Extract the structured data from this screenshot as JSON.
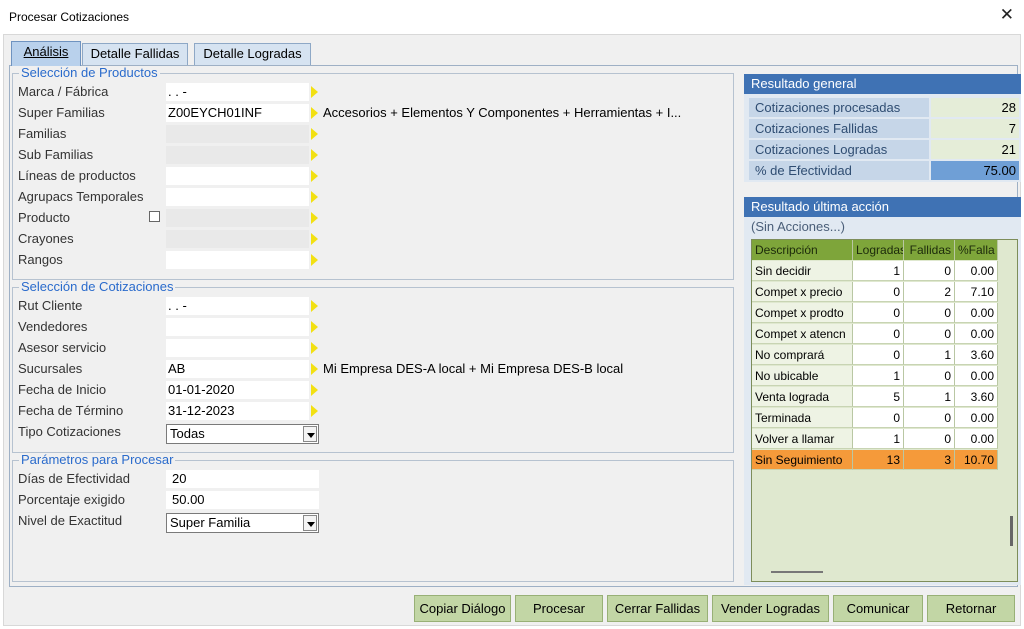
{
  "window": {
    "title": "Procesar Cotizaciones",
    "close_glyph": "✕"
  },
  "tabs": [
    {
      "label": "Análisis"
    },
    {
      "label": "Detalle Fallidas"
    },
    {
      "label": "Detalle Logradas"
    }
  ],
  "productos": {
    "title": "Selección de Productos",
    "marca": {
      "label": "Marca / Fábrica",
      "value": ". .  -"
    },
    "super_familias": {
      "label": "Super Familias",
      "value": "Z00EYCH01INF",
      "desc": "Accesorios + Elementos Y Componentes + Herramientas + I..."
    },
    "familias": {
      "label": "Familias",
      "value": ""
    },
    "sub_familias": {
      "label": "Sub Familias",
      "value": ""
    },
    "lineas": {
      "label": "Líneas de productos",
      "value": ""
    },
    "agrupacs": {
      "label": "Agrupacs Temporales",
      "value": ""
    },
    "producto": {
      "label": "Producto",
      "value": ""
    },
    "crayones": {
      "label": "Crayones",
      "value": ""
    },
    "rangos": {
      "label": "Rangos",
      "value": ""
    }
  },
  "cotizaciones": {
    "title": "Selección de Cotizaciones",
    "rut": {
      "label": "Rut Cliente",
      "value": ". .  -"
    },
    "vendedores": {
      "label": "Vendedores",
      "value": ""
    },
    "asesor": {
      "label": "Asesor servicio",
      "value": ""
    },
    "sucursales": {
      "label": "Sucursales",
      "value": "AB",
      "desc": "Mi Empresa DES-A local + Mi Empresa DES-B local"
    },
    "fecha_inicio": {
      "label": "Fecha de Inicio",
      "value": "01-01-2020"
    },
    "fecha_termino": {
      "label": "Fecha de Término",
      "value": "31-12-2023"
    },
    "tipo": {
      "label": "Tipo Cotizaciones",
      "value": "Todas"
    }
  },
  "parametros": {
    "title": "Parámetros para Procesar",
    "dias": {
      "label": "Días de Efectividad",
      "value": "20"
    },
    "porcentaje": {
      "label": "Porcentaje exigido",
      "value": "50.00"
    },
    "nivel": {
      "label": "Nivel de Exactitud",
      "value": "Super Familia"
    }
  },
  "resultado_general": {
    "title": "Resultado general",
    "rows": [
      {
        "label": "Cotizaciones procesadas",
        "value": "28"
      },
      {
        "label": "Cotizaciones Fallidas",
        "value": "7"
      },
      {
        "label": "Cotizaciones Logradas",
        "value": "21"
      },
      {
        "label": "% de Efectividad",
        "value": "75.00"
      }
    ]
  },
  "resultado_ultima": {
    "title": "Resultado última acción",
    "status": "(Sin Acciones...)",
    "columns": [
      "Descripción",
      "Logradas",
      "Fallidas",
      "%Falla"
    ],
    "rows": [
      [
        "Sin decidir",
        "1",
        "0",
        "0.00"
      ],
      [
        "Compet x precio",
        "0",
        "2",
        "7.10"
      ],
      [
        "Compet x prodto",
        "0",
        "0",
        "0.00"
      ],
      [
        "Compet x atencn",
        "0",
        "0",
        "0.00"
      ],
      [
        "No comprará",
        "0",
        "1",
        "3.60"
      ],
      [
        "No ubicable",
        "1",
        "0",
        "0.00"
      ],
      [
        "Venta lograda",
        "5",
        "1",
        "3.60"
      ],
      [
        "Terminada",
        "0",
        "0",
        "0.00"
      ],
      [
        "Volver a llamar",
        "1",
        "0",
        "0.00"
      ],
      [
        "Sin Seguimiento",
        "13",
        "3",
        "10.70"
      ]
    ]
  },
  "buttons": {
    "copiar": "Copiar Diálogo",
    "procesar": "Procesar",
    "cerrar": "Cerrar Fallidas",
    "vender": "Vender Logradas",
    "comunicar": "Comunicar",
    "retornar": "Retornar"
  }
}
